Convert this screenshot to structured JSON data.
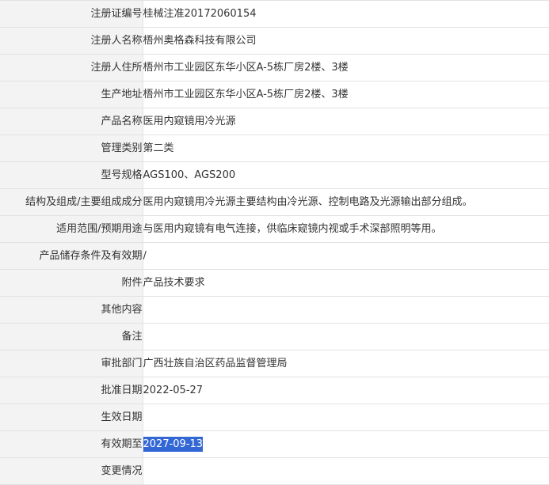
{
  "rows": [
    {
      "label": "注册证编号",
      "value": "桂械注准20172060154"
    },
    {
      "label": "注册人名称",
      "value": "梧州奥格森科技有限公司"
    },
    {
      "label": "注册人住所",
      "value": "梧州市工业园区东华小区A-5栋厂房2楼、3楼"
    },
    {
      "label": "生产地址",
      "value": "梧州市工业园区东华小区A-5栋厂房2楼、3楼"
    },
    {
      "label": "产品名称",
      "value": "医用内窥镜用冷光源"
    },
    {
      "label": "管理类别",
      "value": "第二类"
    },
    {
      "label": "型号规格",
      "value": "AGS100、AGS200"
    },
    {
      "label": "结构及组成/主要组成成分",
      "value": "医用内窥镜用冷光源主要结构由冷光源、控制电路及光源输出部分组成。"
    },
    {
      "label": "适用范围/预期用途",
      "value": "与医用内窥镜有电气连接，供临床窥镜内视或手术深部照明等用。"
    },
    {
      "label": "产品储存条件及有效期",
      "value": "/"
    },
    {
      "label": "附件",
      "value": "产品技术要求"
    },
    {
      "label": "其他内容",
      "value": ""
    },
    {
      "label": "备注",
      "value": ""
    },
    {
      "label": "审批部门",
      "value": "广西壮族自治区药品监督管理局"
    },
    {
      "label": "批准日期",
      "value": "2022-05-27"
    },
    {
      "label": "生效日期",
      "value": ""
    },
    {
      "label": "有效期至",
      "value": "2027-09-13"
    },
    {
      "label": "变更情况",
      "value": ""
    }
  ],
  "colors": {
    "label_bg": "#f3f3f3",
    "border": "#e2e2e2",
    "text": "#333333",
    "selection_bg": "#3367d6",
    "selection_text": "#ffffff"
  }
}
